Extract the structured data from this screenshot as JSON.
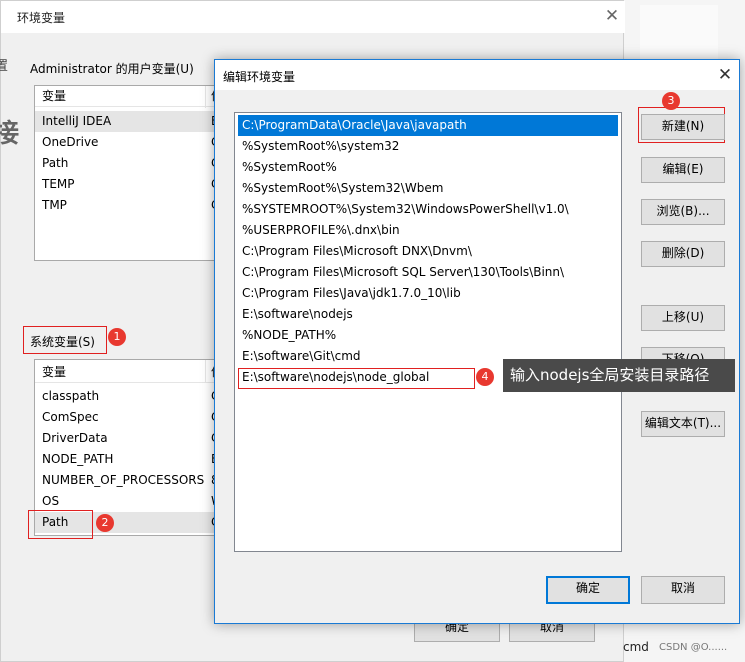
{
  "background_window": {
    "title": "环境变量",
    "user_vars_label": "Administrator 的用户变量(U)",
    "user_vars_header": "变量",
    "user_vars_header_col2": "值",
    "user_vars": [
      {
        "name": "IntelliJ IDEA",
        "value": "E"
      },
      {
        "name": "OneDrive",
        "value": "C"
      },
      {
        "name": "Path",
        "value": "C"
      },
      {
        "name": "TEMP",
        "value": "C"
      },
      {
        "name": "TMP",
        "value": "C"
      }
    ],
    "system_vars_label": "系统变量(S)",
    "system_vars_header": "变量",
    "system_vars_header_col2": "值",
    "system_vars": [
      {
        "name": "classpath",
        "value": "C"
      },
      {
        "name": "ComSpec",
        "value": "C"
      },
      {
        "name": "DriverData",
        "value": "C"
      },
      {
        "name": "NODE_PATH",
        "value": "E"
      },
      {
        "name": "NUMBER_OF_PROCESSORS",
        "value": "8"
      },
      {
        "name": "OS",
        "value": "W"
      },
      {
        "name": "Path",
        "value": "C"
      }
    ],
    "ok_label": "确定",
    "cancel_label": "取消"
  },
  "dialog": {
    "title": "编辑环境变量",
    "paths": [
      "C:\\ProgramData\\Oracle\\Java\\javapath",
      "%SystemRoot%\\system32",
      "%SystemRoot%",
      "%SystemRoot%\\System32\\Wbem",
      "%SYSTEMROOT%\\System32\\WindowsPowerShell\\v1.0\\",
      "%USERPROFILE%\\.dnx\\bin",
      "C:\\Program Files\\Microsoft DNX\\Dnvm\\",
      "C:\\Program Files\\Microsoft SQL Server\\130\\Tools\\Binn\\",
      "C:\\Program Files\\Java\\jdk1.7.0_10\\lib",
      "E:\\software\\nodejs",
      "%NODE_PATH%",
      "E:\\software\\Git\\cmd",
      "E:\\software\\nodejs\\node_global"
    ],
    "selected_index": 0,
    "editing_index": 12,
    "buttons": {
      "new": "新建(N)",
      "edit": "编辑(E)",
      "browse": "浏览(B)...",
      "delete": "删除(D)",
      "move_up": "上移(U)",
      "move_down": "下移(O)",
      "edit_text": "编辑文本(T)...",
      "ok": "确定",
      "cancel": "取消"
    }
  },
  "annotations": {
    "badges": [
      "1",
      "2",
      "3",
      "4"
    ],
    "tooltip": "输入nodejs全局安装目录路径",
    "accent_color": "#e8382f"
  },
  "side_strip": {
    "left_fragment_1": "置",
    "left_fragment_2": "接",
    "footer_text": "cmd",
    "watermark": "CSDN @O......"
  },
  "colors": {
    "selection": "#0078d7",
    "dialog_border": "#1a7ad4"
  }
}
